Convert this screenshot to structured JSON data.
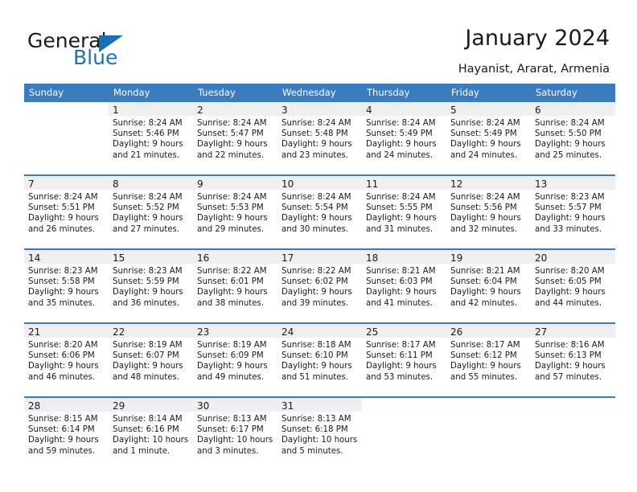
{
  "brand": {
    "name_part1": "General",
    "name_part2": "Blue",
    "flag_icon": "blue-triangle-flag-icon",
    "accent_color": "#1e72b8"
  },
  "header": {
    "title": "January 2024",
    "subtitle": "Hayanist, Ararat, Armenia"
  },
  "calendar": {
    "header_bg_color": "#3a7cbe",
    "datenum_bg_color": "#efefef",
    "weekday_headers": [
      "Sunday",
      "Monday",
      "Tuesday",
      "Wednesday",
      "Thursday",
      "Friday",
      "Saturday"
    ],
    "weeks": [
      [
        {
          "day": "",
          "lines": []
        },
        {
          "day": "1",
          "lines": [
            "Sunrise: 8:24 AM",
            "Sunset: 5:46 PM",
            "Daylight: 9 hours",
            "and 21 minutes."
          ]
        },
        {
          "day": "2",
          "lines": [
            "Sunrise: 8:24 AM",
            "Sunset: 5:47 PM",
            "Daylight: 9 hours",
            "and 22 minutes."
          ]
        },
        {
          "day": "3",
          "lines": [
            "Sunrise: 8:24 AM",
            "Sunset: 5:48 PM",
            "Daylight: 9 hours",
            "and 23 minutes."
          ]
        },
        {
          "day": "4",
          "lines": [
            "Sunrise: 8:24 AM",
            "Sunset: 5:49 PM",
            "Daylight: 9 hours",
            "and 24 minutes."
          ]
        },
        {
          "day": "5",
          "lines": [
            "Sunrise: 8:24 AM",
            "Sunset: 5:49 PM",
            "Daylight: 9 hours",
            "and 24 minutes."
          ]
        },
        {
          "day": "6",
          "lines": [
            "Sunrise: 8:24 AM",
            "Sunset: 5:50 PM",
            "Daylight: 9 hours",
            "and 25 minutes."
          ]
        }
      ],
      [
        {
          "day": "7",
          "lines": [
            "Sunrise: 8:24 AM",
            "Sunset: 5:51 PM",
            "Daylight: 9 hours",
            "and 26 minutes."
          ]
        },
        {
          "day": "8",
          "lines": [
            "Sunrise: 8:24 AM",
            "Sunset: 5:52 PM",
            "Daylight: 9 hours",
            "and 27 minutes."
          ]
        },
        {
          "day": "9",
          "lines": [
            "Sunrise: 8:24 AM",
            "Sunset: 5:53 PM",
            "Daylight: 9 hours",
            "and 29 minutes."
          ]
        },
        {
          "day": "10",
          "lines": [
            "Sunrise: 8:24 AM",
            "Sunset: 5:54 PM",
            "Daylight: 9 hours",
            "and 30 minutes."
          ]
        },
        {
          "day": "11",
          "lines": [
            "Sunrise: 8:24 AM",
            "Sunset: 5:55 PM",
            "Daylight: 9 hours",
            "and 31 minutes."
          ]
        },
        {
          "day": "12",
          "lines": [
            "Sunrise: 8:24 AM",
            "Sunset: 5:56 PM",
            "Daylight: 9 hours",
            "and 32 minutes."
          ]
        },
        {
          "day": "13",
          "lines": [
            "Sunrise: 8:23 AM",
            "Sunset: 5:57 PM",
            "Daylight: 9 hours",
            "and 33 minutes."
          ]
        }
      ],
      [
        {
          "day": "14",
          "lines": [
            "Sunrise: 8:23 AM",
            "Sunset: 5:58 PM",
            "Daylight: 9 hours",
            "and 35 minutes."
          ]
        },
        {
          "day": "15",
          "lines": [
            "Sunrise: 8:23 AM",
            "Sunset: 5:59 PM",
            "Daylight: 9 hours",
            "and 36 minutes."
          ]
        },
        {
          "day": "16",
          "lines": [
            "Sunrise: 8:22 AM",
            "Sunset: 6:01 PM",
            "Daylight: 9 hours",
            "and 38 minutes."
          ]
        },
        {
          "day": "17",
          "lines": [
            "Sunrise: 8:22 AM",
            "Sunset: 6:02 PM",
            "Daylight: 9 hours",
            "and 39 minutes."
          ]
        },
        {
          "day": "18",
          "lines": [
            "Sunrise: 8:21 AM",
            "Sunset: 6:03 PM",
            "Daylight: 9 hours",
            "and 41 minutes."
          ]
        },
        {
          "day": "19",
          "lines": [
            "Sunrise: 8:21 AM",
            "Sunset: 6:04 PM",
            "Daylight: 9 hours",
            "and 42 minutes."
          ]
        },
        {
          "day": "20",
          "lines": [
            "Sunrise: 8:20 AM",
            "Sunset: 6:05 PM",
            "Daylight: 9 hours",
            "and 44 minutes."
          ]
        }
      ],
      [
        {
          "day": "21",
          "lines": [
            "Sunrise: 8:20 AM",
            "Sunset: 6:06 PM",
            "Daylight: 9 hours",
            "and 46 minutes."
          ]
        },
        {
          "day": "22",
          "lines": [
            "Sunrise: 8:19 AM",
            "Sunset: 6:07 PM",
            "Daylight: 9 hours",
            "and 48 minutes."
          ]
        },
        {
          "day": "23",
          "lines": [
            "Sunrise: 8:19 AM",
            "Sunset: 6:09 PM",
            "Daylight: 9 hours",
            "and 49 minutes."
          ]
        },
        {
          "day": "24",
          "lines": [
            "Sunrise: 8:18 AM",
            "Sunset: 6:10 PM",
            "Daylight: 9 hours",
            "and 51 minutes."
          ]
        },
        {
          "day": "25",
          "lines": [
            "Sunrise: 8:17 AM",
            "Sunset: 6:11 PM",
            "Daylight: 9 hours",
            "and 53 minutes."
          ]
        },
        {
          "day": "26",
          "lines": [
            "Sunrise: 8:17 AM",
            "Sunset: 6:12 PM",
            "Daylight: 9 hours",
            "and 55 minutes."
          ]
        },
        {
          "day": "27",
          "lines": [
            "Sunrise: 8:16 AM",
            "Sunset: 6:13 PM",
            "Daylight: 9 hours",
            "and 57 minutes."
          ]
        }
      ],
      [
        {
          "day": "28",
          "lines": [
            "Sunrise: 8:15 AM",
            "Sunset: 6:14 PM",
            "Daylight: 9 hours",
            "and 59 minutes."
          ]
        },
        {
          "day": "29",
          "lines": [
            "Sunrise: 8:14 AM",
            "Sunset: 6:16 PM",
            "Daylight: 10 hours",
            "and 1 minute."
          ]
        },
        {
          "day": "30",
          "lines": [
            "Sunrise: 8:13 AM",
            "Sunset: 6:17 PM",
            "Daylight: 10 hours",
            "and 3 minutes."
          ]
        },
        {
          "day": "31",
          "lines": [
            "Sunrise: 8:13 AM",
            "Sunset: 6:18 PM",
            "Daylight: 10 hours",
            "and 5 minutes."
          ]
        },
        {
          "day": "",
          "lines": []
        },
        {
          "day": "",
          "lines": []
        },
        {
          "day": "",
          "lines": []
        }
      ]
    ]
  }
}
